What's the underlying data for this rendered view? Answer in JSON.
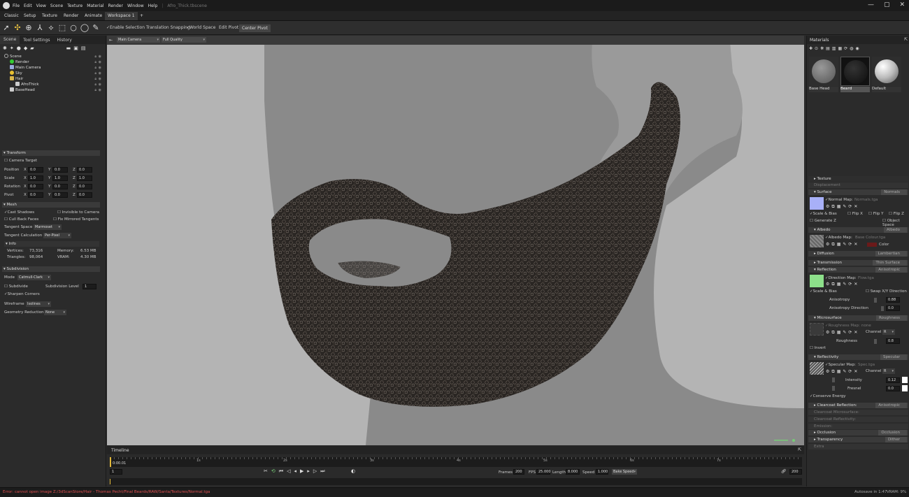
{
  "app": {
    "title": "Afro_Thick.tbscene",
    "menus": [
      "File",
      "Edit",
      "View",
      "Scene",
      "Texture",
      "Material",
      "Render",
      "Window",
      "Help"
    ],
    "window_controls": [
      "—",
      "▢",
      "✕"
    ]
  },
  "tabs": [
    "Classic",
    "Setup",
    "Texture",
    "Render",
    "Animate",
    "Workspace 1",
    "+"
  ],
  "toolbar": {
    "enable_selection": "✓Enable Selection",
    "translation_snapping": "Translation Snapping",
    "world_space": "✓World Space",
    "edit_pivot": "Edit Pivot",
    "center_pivot": "Center Pivot"
  },
  "left": {
    "tabs": [
      "Scene",
      "Tool Settings",
      "History"
    ],
    "tree": [
      {
        "label": "Scene"
      },
      {
        "label": "Render"
      },
      {
        "label": "Main Camera"
      },
      {
        "label": "Sky"
      },
      {
        "label": "Hair"
      },
      {
        "label": "AfroThick"
      },
      {
        "label": "BaseHead"
      }
    ],
    "transform": {
      "title": "Transform",
      "camera_target": "Camera Target",
      "position": "Position",
      "scale": "Scale",
      "rotation": "Rotation",
      "pivot": "Pivot",
      "x": "X",
      "y": "Y",
      "z": "Z",
      "position_vals": [
        "0.0",
        "0.0",
        "0.0"
      ],
      "scale_vals": [
        "1.0",
        "1.0",
        "1.0"
      ],
      "rotation_vals": [
        "0.0",
        "0.0",
        "0.0"
      ],
      "pivot_vals": [
        "0.0",
        "0.0",
        "0.0"
      ]
    },
    "mesh": {
      "title": "Mesh",
      "cast_shadows": "✓Cast Shadows",
      "invisible_to_camera": "Invisible to Camera",
      "cull_back_faces": "Cull Back Faces",
      "fix_mirrored": "Fix Mirrored Tangents",
      "tangent_space": "Tangent Space",
      "tangent_space_val": "Marmoset",
      "tangent_calc": "Tangent Calculation",
      "tangent_calc_val": "Per-Pixel",
      "info": "Info",
      "vertices_lbl": "Vertices:",
      "vertices": "73,316",
      "triangles_lbl": "Triangles:",
      "triangles": "98,064",
      "memory_lbl": "Memory:",
      "memory": "6.53 MB",
      "vram_lbl": "VRAM:",
      "vram": "4.30 MB"
    },
    "subdivision": {
      "title": "Subdivision",
      "mode": "Mode",
      "mode_val": "Catmull-Clark",
      "subdivide": "Subdivide",
      "level_lbl": "Subdivision Level",
      "level": "1",
      "sharpen": "✓Sharpen Corners",
      "wireframe": "Wireframe",
      "wireframe_val": "Isolines",
      "reduction": "Geometry Reduction",
      "reduction_val": "None"
    }
  },
  "viewport": {
    "camera": "Main Camera",
    "quality": "Full Quality"
  },
  "timeline": {
    "title": "Timeline",
    "time": "0:00.01",
    "ticks": [
      "1s",
      "2s",
      "3s",
      "4s",
      "5s",
      "6s",
      "7s"
    ],
    "frame": "1",
    "frames_lbl": "Frames",
    "frames": "200",
    "fps_lbl": "FPS",
    "fps": "25.000",
    "length_lbl": "Length",
    "length": "8.000",
    "speed_lbl": "Speed",
    "speed": "1.000",
    "bake": "Bake Speed",
    "end": "200"
  },
  "status": {
    "error": "Error: cannot open image Z:/3dScanStore/Hair - Thomas Pecht/Final Beards/RAW/Santa/Textures/Normal.tga",
    "autosave": "Autosave in 1:47",
    "vram": "VRAM: 9%"
  },
  "right": {
    "title": "Materials",
    "materials": [
      "Base Head",
      "Beard",
      "Default"
    ],
    "texture": "Texture",
    "displacement": "Displacement",
    "surface": "Surface",
    "surface_val": "Normals",
    "normal_map": "✓Normal Map:",
    "normal_map_file": "Normals.tga",
    "scale_bias": "✓Scale & Bias",
    "flip_x": "Flip X",
    "flip_y": "Flip Y",
    "flip_z": "Flip Z",
    "generate_z": "Generate Z",
    "object_space": "Object Space",
    "albedo": "Albedo",
    "albedo_val": "Albedo",
    "albedo_map": "✓Albedo Map:",
    "albedo_file": "Base Colour.tga",
    "color": "Color",
    "diffusion": "Diffusion",
    "diffusion_val": "Lambertian",
    "transmission": "Transmission",
    "transmission_val": "Thin Surface",
    "reflection": "Reflection",
    "reflection_val": "Anisotropic",
    "direction_map": "✓Direction Map:",
    "direction_file": "Flow.tga",
    "scale_bias2": "✓Scale & Bias",
    "swap_xy": "Swap X/Y Direction",
    "anisotropy": "Anisotropy",
    "anisotropy_val": "0.88",
    "aniso_dir": "Anisotropy Direction",
    "aniso_dir_val": "0.0",
    "microsurface": "Microsurface",
    "microsurface_val": "Roughness",
    "roughness_map": "✓Roughness Map:",
    "roughness_file": "none",
    "channel": "Channel",
    "channel_val": "R",
    "roughness": "Roughness",
    "roughness_val": "0.8",
    "invert": "Invert",
    "reflectivity": "Reflectivity",
    "reflectivity_val": "Specular",
    "specular_map": "✓Specular Map:",
    "specular_file": "Spec.tga",
    "channel2": "Channel",
    "channel2_val": "R",
    "intensity": "Intensity",
    "intensity_val": "0.12",
    "fresnel": "Fresnel",
    "fresnel_val": "0.0",
    "conserve": "✓Conserve Energy",
    "clearcoat_reflection": "Clearcoat Reflection:",
    "clearcoat_reflection_val": "Anisotropic",
    "clearcoat_micro": "Clearcoat Microsurface:",
    "clearcoat_refl": "Clearcoat Reflectivity:",
    "emission": "Emission:",
    "occlusion": "Occlusion",
    "occlusion_val": "Occlusion",
    "transparency": "Transparency",
    "transparency_val": "Dither",
    "extra": "Extra"
  }
}
